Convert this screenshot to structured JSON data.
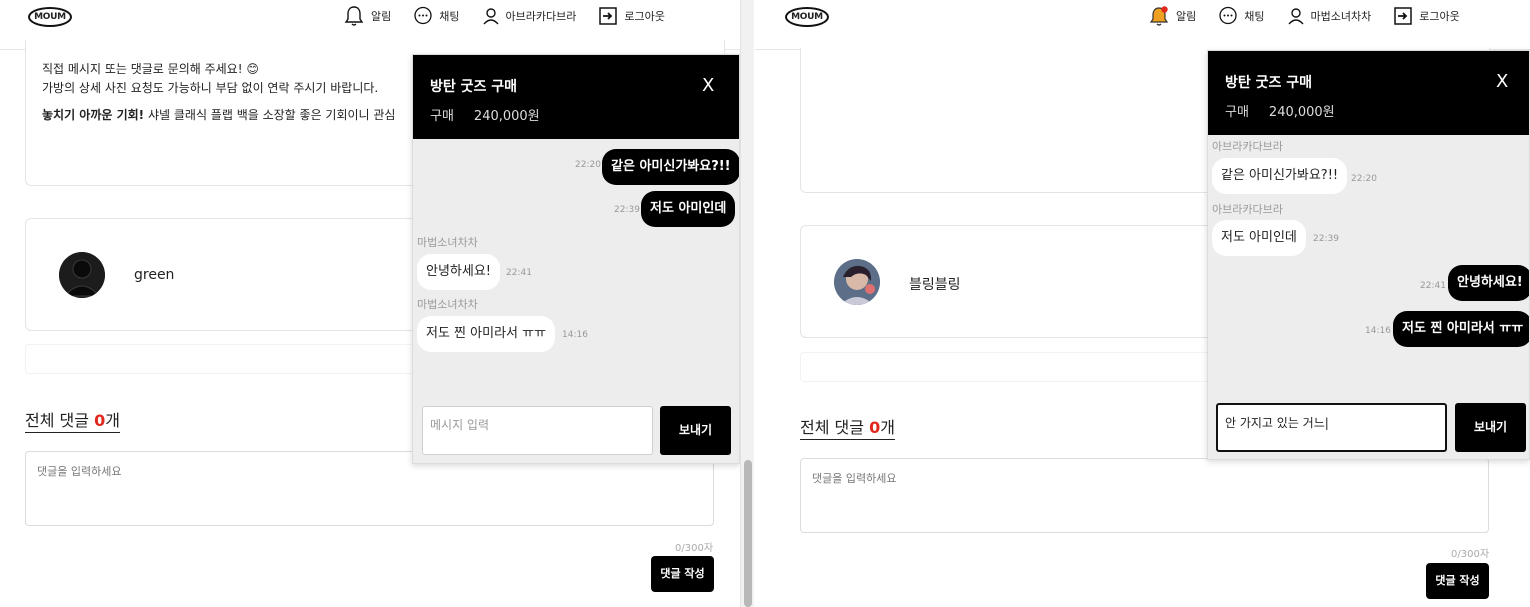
{
  "left": {
    "header": {
      "logo": "MOUM",
      "nav": [
        {
          "icon": "bell-icon",
          "label": "알림"
        },
        {
          "icon": "chat-bubble-icon",
          "label": "채팅"
        },
        {
          "icon": "user-icon",
          "label": "아브라카다브라"
        },
        {
          "icon": "logout-icon",
          "label": "로그아웃"
        }
      ]
    },
    "description": {
      "line1": "직접 메시지 또는 댓글로 문의해 주세요! 😊",
      "line2": "가방의 상세 사진 요청도 가능하니 부담 없이 연락 주시기 바랍니다.",
      "line3_bold": "놓치기 아까운 기회!",
      "line3_rest": " 샤넬 클래식 플랩 백을 소장할 좋은 기회이니 관심"
    },
    "seller": {
      "name": "green"
    },
    "comments": {
      "title_prefix": "전체 댓글 ",
      "count": "0",
      "title_suffix": "개",
      "placeholder": "댓글을 입력하세요",
      "counter": "0/300자",
      "submit": "댓글 작성"
    },
    "chat": {
      "title": "방탄 굿즈 구매",
      "sub_label": "구매",
      "sub_price": "240,000원",
      "close": "X",
      "messages": [
        {
          "from": "me",
          "text": "같은 아미신가봐요?!!",
          "time": "22:20"
        },
        {
          "from": "me",
          "text": "저도 아미인데",
          "time": "22:39"
        },
        {
          "from": "other",
          "sender": "마법소녀차차",
          "text": "안녕하세요!",
          "time": "22:41"
        },
        {
          "from": "other",
          "sender": "마법소녀차차",
          "text": "저도 찐 아미라서 ㅠㅠ",
          "time": "14:16"
        }
      ],
      "input_placeholder": "메시지 입력",
      "send": "보내기"
    }
  },
  "right": {
    "header": {
      "logo": "MOUM",
      "nav": [
        {
          "icon": "bell-notification-icon",
          "label": "알림"
        },
        {
          "icon": "chat-bubble-icon",
          "label": "채팅"
        },
        {
          "icon": "user-icon",
          "label": "마법소녀차차"
        },
        {
          "icon": "logout-icon",
          "label": "로그아웃"
        }
      ]
    },
    "seller": {
      "name": "블링블링"
    },
    "comments": {
      "title_prefix": "전체 댓글 ",
      "count": "0",
      "title_suffix": "개",
      "placeholder": "댓글을 입력하세요",
      "counter": "0/300자",
      "submit": "댓글 작성"
    },
    "chat": {
      "title": "방탄 굿즈 구매",
      "sub_label": "구매",
      "sub_price": "240,000원",
      "close": "X",
      "messages": [
        {
          "from": "other",
          "sender": "아브라카다브라",
          "text": "같은 아미신가봐요?!!",
          "time": "22:20"
        },
        {
          "from": "other",
          "sender": "아브라카다브라",
          "text": "저도 아미인데",
          "time": "22:39"
        },
        {
          "from": "me",
          "text": "안녕하세요!",
          "time": "22:41"
        },
        {
          "from": "me",
          "text": "저도 찐 아미라서 ㅠㅠ",
          "time": "14:16"
        }
      ],
      "input_value": "안 가지고 있는 거느|",
      "send": "보내기"
    }
  },
  "colors": {
    "accent": "#e0281e",
    "chat_header": "#000000",
    "chat_bg": "#ededed",
    "notification": "#f0a020"
  }
}
